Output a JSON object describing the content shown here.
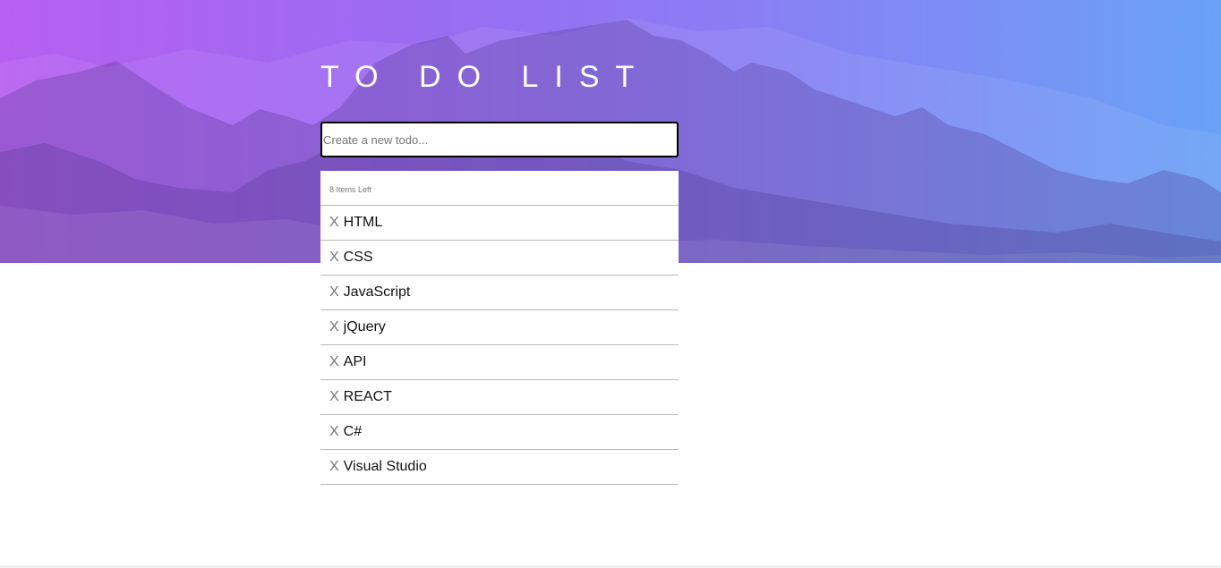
{
  "header": {
    "title": "TO DO LIST",
    "background_gradient": [
      "#b65ff0",
      "#8a7df4",
      "#6aa2f6"
    ]
  },
  "new_todo": {
    "placeholder": "Create a new todo...",
    "value": ""
  },
  "list": {
    "items_left_text": "8 Items Left",
    "delete_glyph": "X",
    "items": [
      {
        "label": "HTML"
      },
      {
        "label": "CSS"
      },
      {
        "label": "JavaScript"
      },
      {
        "label": "jQuery"
      },
      {
        "label": "API"
      },
      {
        "label": "REACT"
      },
      {
        "label": "C#"
      },
      {
        "label": "Visual Studio"
      }
    ]
  }
}
